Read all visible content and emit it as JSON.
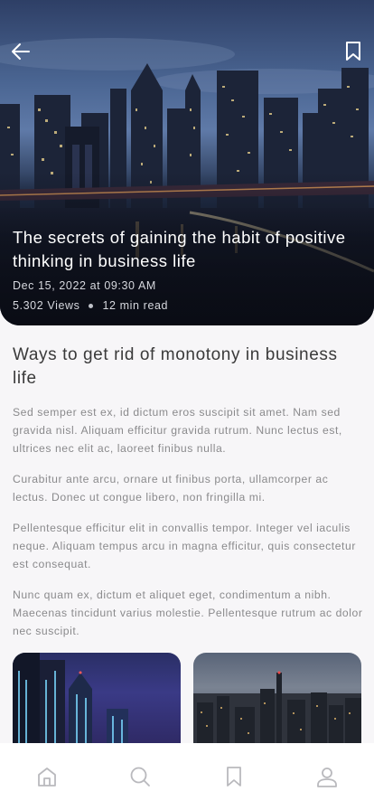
{
  "hero": {
    "title": "The secrets of gaining the habit of positive thinking in business life",
    "date": "Dec 15, 2022 at 09:30 AM",
    "views": "5.302 Views",
    "read_time": "12 min read"
  },
  "article": {
    "heading": "Ways to get rid of monotony in business life",
    "paragraphs": [
      "Sed semper est ex, id dictum eros suscipit sit amet. Nam sed gravida nisl. Aliquam efficitur gravida rutrum. Nunc lectus est, ultrices nec elit ac, laoreet finibus nulla.",
      "Curabitur ante arcu, ornare ut finibus porta, ullamcorper ac lectus. Donec ut congue libero, non fringilla mi.",
      "Pellentesque efficitur elit in convallis tempor. Integer vel iaculis neque. Aliquam tempus arcu in magna efficitur, quis consectetur est consequat.",
      "Nunc quam ex, dictum et aliquet eget, condimentum a nibh. Maecenas tincidunt varius molestie. Pellentesque rutrum ac dolor nec suscipit."
    ]
  },
  "icons": {
    "back": "arrow-left-icon",
    "bookmark": "bookmark-icon",
    "nav": [
      "home-icon",
      "search-icon",
      "bookmark-icon",
      "profile-icon"
    ]
  },
  "colors": {
    "background": "#f7f6f8",
    "heading": "#3a3a3a",
    "body_text": "#8a8a8c",
    "nav_icon": "#b9b9bd"
  }
}
